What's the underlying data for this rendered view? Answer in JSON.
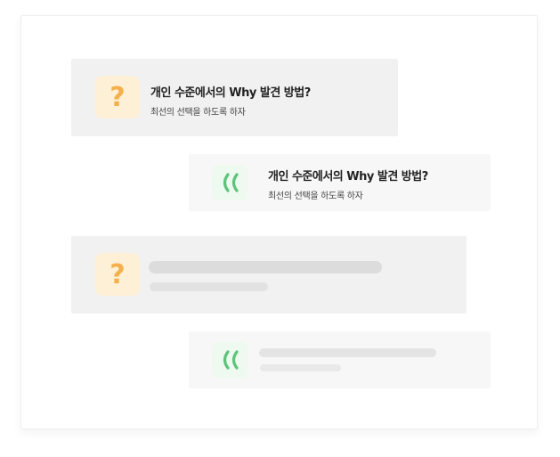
{
  "cards": [
    {
      "type": "question",
      "icon": "question-mark-icon",
      "badge_text": "?",
      "title": "개인 수준에서의 Why 발견 방법?",
      "subtitle": "최선의 선택을 하도록 하자"
    },
    {
      "type": "answer",
      "icon": "quote-icon",
      "title": "개인 수준에서의 Why 발견 방법?",
      "subtitle": "최선의 선택을 하도록 하자"
    },
    {
      "type": "question-skeleton",
      "icon": "question-mark-icon",
      "badge_text": "?"
    },
    {
      "type": "answer-skeleton",
      "icon": "quote-icon"
    }
  ],
  "colors": {
    "question_badge_bg": "#fdf0d6",
    "question_mark": "#f3b04b",
    "quote_badge_bg": "#eefaf0",
    "quote_mark": "#5cc37a",
    "card_question_bg": "#f1f1f1",
    "card_answer_bg": "#f7f7f7",
    "skeleton_dark": "#dcdcdc",
    "skeleton_light": "#e6e6e6"
  }
}
